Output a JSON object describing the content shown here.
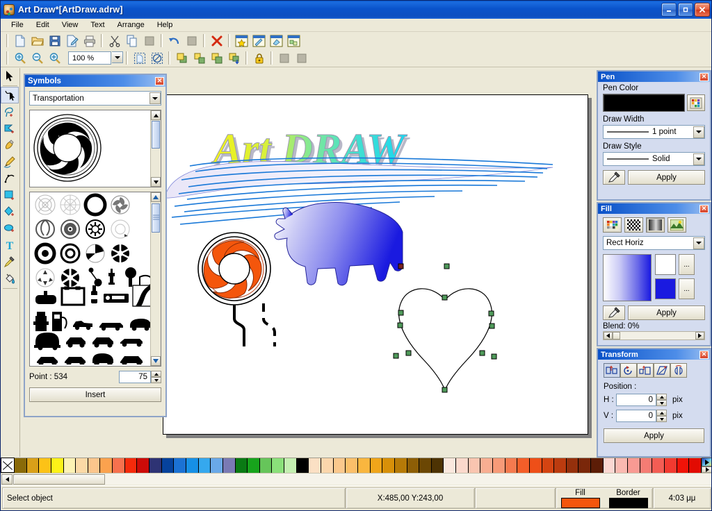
{
  "window": {
    "title": "Art Draw*[ArtDraw.adrw]",
    "icon": "palette-icon",
    "minimize_label": "_",
    "maximize_label": "❐",
    "close_label": "✕"
  },
  "menu": {
    "items": [
      "File",
      "Edit",
      "View",
      "Text",
      "Arrange",
      "Help"
    ]
  },
  "toolbar_main": {
    "items": [
      {
        "name": "new-file-icon",
        "tip": "New"
      },
      {
        "name": "open-folder-icon",
        "tip": "Open"
      },
      {
        "name": "save-icon",
        "tip": "Save"
      },
      {
        "name": "save-as-icon",
        "tip": "Save As"
      },
      {
        "name": "print-icon",
        "tip": "Print"
      },
      {
        "name": "cut-scissors-icon",
        "tip": "Cut"
      },
      {
        "name": "copy-icon",
        "tip": "Copy"
      },
      {
        "name": "paste-icon",
        "tip": "Paste"
      },
      {
        "name": "undo-icon",
        "tip": "Undo"
      },
      {
        "name": "redo-icon",
        "tip": "Redo"
      },
      {
        "name": "delete-x-icon",
        "tip": "Delete"
      },
      {
        "name": "symbols-panel-icon",
        "tip": "Symbols"
      },
      {
        "name": "pen-panel-icon",
        "tip": "Pen"
      },
      {
        "name": "fill-panel-icon",
        "tip": "Fill"
      },
      {
        "name": "transform-panel-icon",
        "tip": "Transform"
      }
    ]
  },
  "toolbar_view": {
    "zoom_value": "100 %",
    "items": [
      {
        "name": "zoom-fit-icon",
        "tip": "Zoom to fit"
      },
      {
        "name": "zoom-out-icon",
        "tip": "Zoom out"
      },
      {
        "name": "zoom-in-icon",
        "tip": "Zoom in"
      },
      {
        "name": "select-all-icon",
        "tip": "Select all"
      },
      {
        "name": "deselect-icon",
        "tip": "Deselect"
      },
      {
        "name": "bring-to-front-icon",
        "tip": "Bring to front"
      },
      {
        "name": "bring-forward-icon",
        "tip": "Bring forward"
      },
      {
        "name": "send-backward-icon",
        "tip": "Send backward"
      },
      {
        "name": "send-to-back-icon",
        "tip": "Send to back"
      },
      {
        "name": "lock-icon",
        "tip": "Lock"
      },
      {
        "name": "group-icon",
        "tip": "Group"
      },
      {
        "name": "ungroup-icon",
        "tip": "Ungroup"
      }
    ]
  },
  "tools": [
    {
      "name": "select-tool",
      "label": "Select"
    },
    {
      "name": "node-edit-tool",
      "label": "Node Edit"
    },
    {
      "name": "lasso-tool",
      "label": "Lasso"
    },
    {
      "name": "polygon-select-tool",
      "label": "Polygon Select"
    },
    {
      "name": "pencil-tool",
      "label": "Pencil"
    },
    {
      "name": "pen-tool",
      "label": "Pen"
    },
    {
      "name": "curve-tool",
      "label": "Curve"
    },
    {
      "name": "rectangle-tool",
      "label": "Rectangle"
    },
    {
      "name": "polygon-tool",
      "label": "Polygon"
    },
    {
      "name": "ellipse-tool",
      "label": "Ellipse"
    },
    {
      "name": "text-tool",
      "label": "Text"
    },
    {
      "name": "eyedropper-tool",
      "label": "Eyedropper"
    },
    {
      "name": "paint-bucket-tool",
      "label": "Paint Bucket"
    }
  ],
  "symbols_panel": {
    "title": "Symbols",
    "close_label": "✕",
    "category": "Transportation",
    "point_label": "Point : 534",
    "size_value": "75",
    "insert_label": "Insert"
  },
  "pen_panel": {
    "title": "Pen",
    "close_label": "✕",
    "pen_color_label": "Pen Color",
    "pen_color": "#000000",
    "draw_width_label": "Draw Width",
    "draw_width_value": "1 point",
    "draw_style_label": "Draw Style",
    "draw_style_value": "Solid",
    "apply_label": "Apply"
  },
  "fill_panel": {
    "title": "Fill",
    "close_label": "✕",
    "mode_value": "Rect Horiz",
    "color_start": "#ffffff",
    "color_end": "#1a1ae0",
    "more_label": "...",
    "apply_label": "Apply",
    "blend_label": "Blend: 0%",
    "modes": [
      {
        "name": "solid-fill-icon"
      },
      {
        "name": "pattern-fill-icon"
      },
      {
        "name": "gradient-fill-icon"
      },
      {
        "name": "texture-fill-icon"
      }
    ]
  },
  "transform_panel": {
    "title": "Transform",
    "close_label": "✕",
    "position_label": "Position :",
    "h_label": "H :",
    "h_value": "0",
    "v_label": "V :",
    "v_value": "0",
    "unit": "pix",
    "apply_label": "Apply",
    "buttons": [
      {
        "name": "move-transform-icon"
      },
      {
        "name": "rotate-transform-icon"
      },
      {
        "name": "scale-transform-icon"
      },
      {
        "name": "skew-transform-icon"
      },
      {
        "name": "mirror-transform-icon"
      }
    ]
  },
  "canvas": {
    "artwork_title": "Art DRAW",
    "objects": [
      {
        "name": "art-draw-wordart",
        "type": "text"
      },
      {
        "name": "blue-swoosh-lines",
        "type": "vector"
      },
      {
        "name": "orange-wheel-symbol",
        "type": "symbol"
      },
      {
        "name": "blue-gradient-panther",
        "type": "vector"
      },
      {
        "name": "heart-shape-selected",
        "type": "path",
        "selected": true
      }
    ]
  },
  "status_bar": {
    "message": "Select object",
    "coordinates": "X:485,00 Y:243,00",
    "fill_label": "Fill",
    "border_label": "Border",
    "fill_color": "#f4560c",
    "border_color": "#000000",
    "time": "4:03 μμ"
  },
  "color_palette": {
    "no_fill_label": "",
    "row": [
      "#8a6a08",
      "#d9a019",
      "#fcc217",
      "#fdf218",
      "#fdf2b4",
      "#fbd9a6",
      "#fbc58c",
      "#fba24e",
      "#f7714e",
      "#f52a0b",
      "#cc0b08",
      "#2e3374",
      "#06429c",
      "#1b72d4",
      "#1690e6",
      "#35a8ee",
      "#6aa9e8",
      "#7a7ab4",
      "#0a7a14",
      "#17a41c",
      "#66c55a",
      "#8ae07a",
      "#c3efb0",
      "#000000",
      "#fbe0c4",
      "#fbd6ac",
      "#fbc88d",
      "#fbbf6a",
      "#f9b63f",
      "#f0a51a",
      "#d79009",
      "#b67a07",
      "#8d5e06",
      "#6b4704",
      "#4d3303",
      "#fae8de",
      "#fbd9cc",
      "#f9c5b0",
      "#f8ae92",
      "#f79a78",
      "#f57a4f",
      "#f45e29",
      "#ee4f18",
      "#d44412",
      "#bb3b0f",
      "#95300c",
      "#7a270a",
      "#5c1d07",
      "#fbd7d2",
      "#fab9b1",
      "#f89a93",
      "#f57c74",
      "#f35d54",
      "#f23a30",
      "#f01308",
      "#e20b02"
    ]
  }
}
